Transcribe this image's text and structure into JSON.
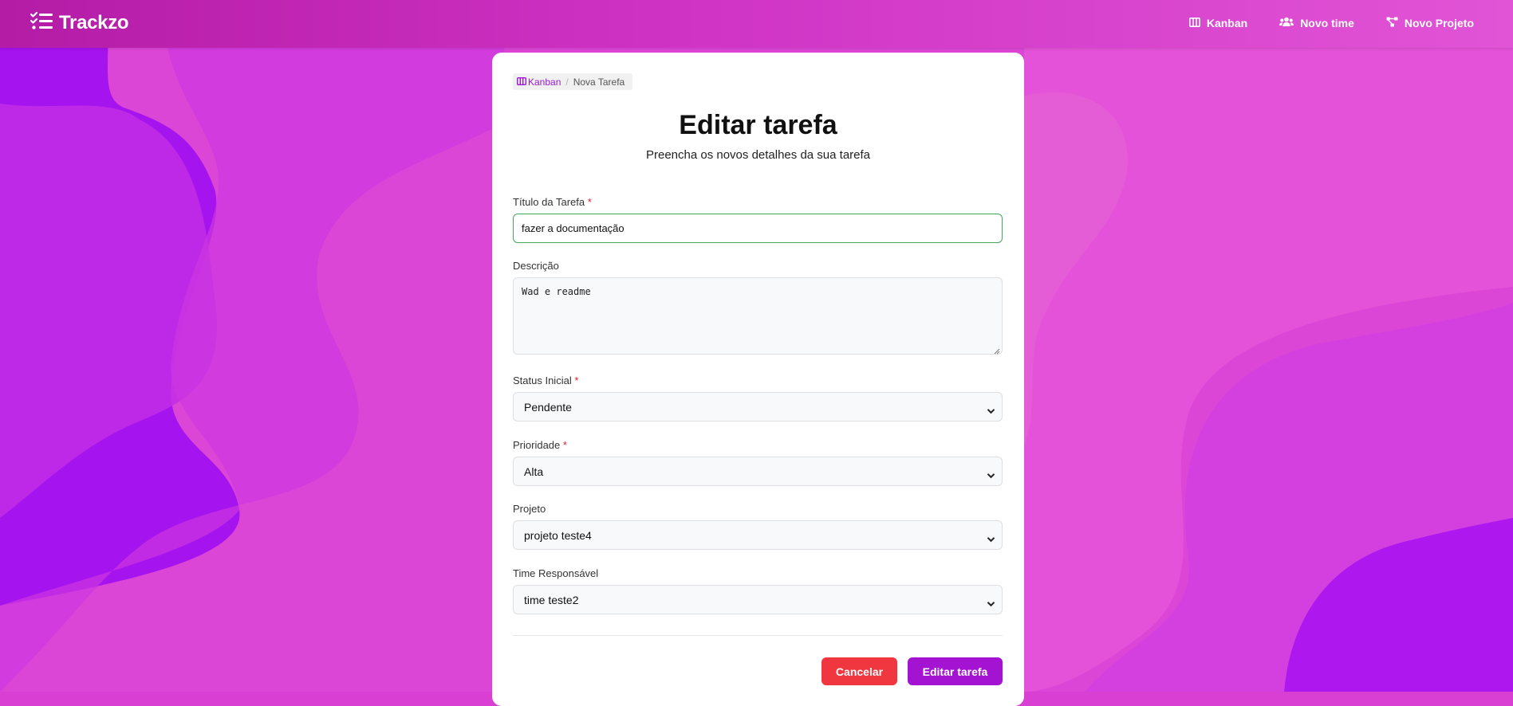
{
  "navbar": {
    "brand": "Trackzo",
    "links": [
      {
        "label": "Kanban",
        "icon": "kanban-icon"
      },
      {
        "label": "Novo time",
        "icon": "users-icon"
      },
      {
        "label": "Novo Projeto",
        "icon": "project-icon"
      }
    ]
  },
  "breadcrumb": {
    "link": "Kanban",
    "separator": "/",
    "current": "Nova Tarefa"
  },
  "form": {
    "title": "Editar tarefa",
    "subtitle": "Preencha os novos detalhes da sua tarefa",
    "required_mark": "*",
    "fields": {
      "titulo": {
        "label": "Título da Tarefa",
        "value": "fazer a documentação"
      },
      "descricao": {
        "label": "Descrição",
        "value": "Wad e readme"
      },
      "status": {
        "label": "Status Inicial",
        "value": "Pendente"
      },
      "prioridade": {
        "label": "Prioridade",
        "value": "Alta"
      },
      "projeto": {
        "label": "Projeto",
        "value": "projeto teste4"
      },
      "time": {
        "label": "Time Responsável",
        "value": "time teste2"
      }
    },
    "cancel_label": "Cancelar",
    "submit_label": "Editar tarefa"
  },
  "colors": {
    "accent": "#a313d1",
    "cancel": "#f0363f",
    "focus_border": "#47a559",
    "required": "#e0202c"
  }
}
